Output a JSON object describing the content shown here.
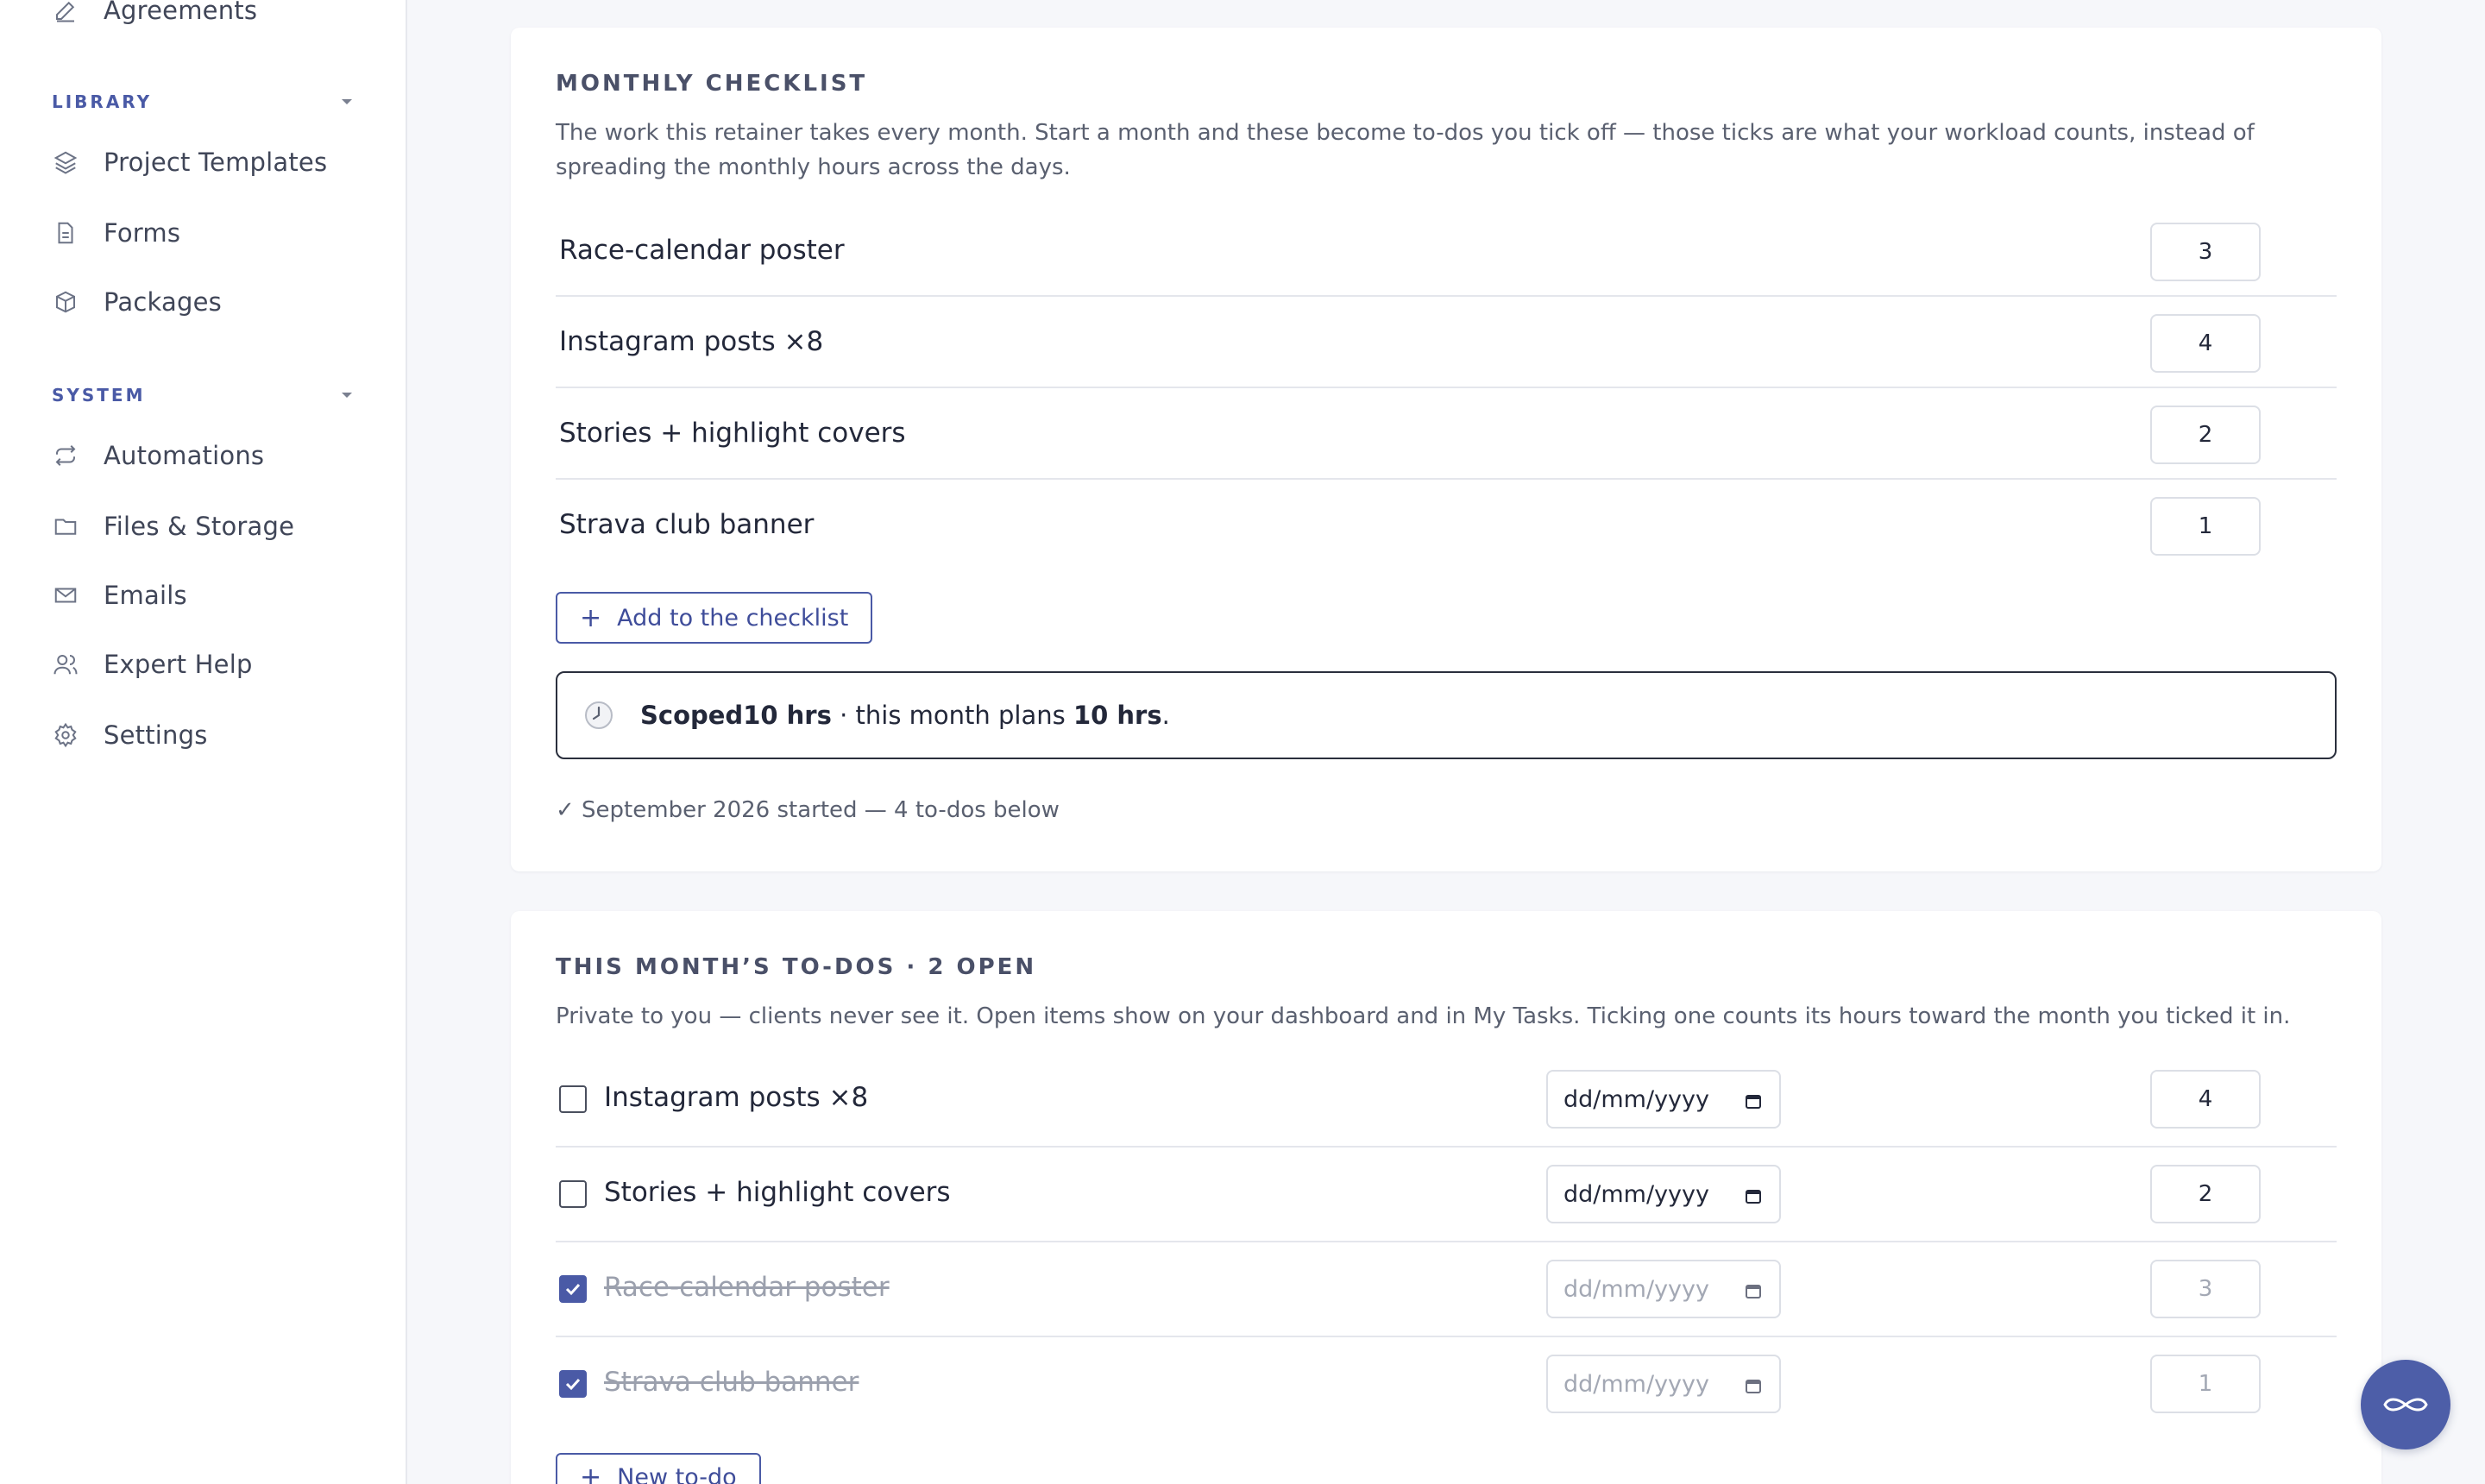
{
  "sidebar": {
    "top_item": "Agreements",
    "library": {
      "heading": "LIBRARY",
      "items": [
        "Project Templates",
        "Forms",
        "Packages"
      ]
    },
    "system": {
      "heading": "SYSTEM",
      "items": [
        "Automations",
        "Files & Storage",
        "Emails",
        "Expert Help",
        "Settings"
      ]
    },
    "icons": [
      "pencil-icon",
      "layers-icon",
      "document-icon",
      "box-icon",
      "refresh-icon",
      "folder-icon",
      "mail-icon",
      "users-icon",
      "gear-icon"
    ]
  },
  "checklist": {
    "title": "MONTHLY CHECKLIST",
    "description": "The work this retainer takes every month. Start a month and these become to-dos you tick off — those ticks are what your workload counts, instead of spreading the monthly hours across the days.",
    "items": [
      {
        "name": "Race-calendar poster",
        "hours": "3"
      },
      {
        "name": "Instagram posts ×8",
        "hours": "4"
      },
      {
        "name": "Stories + highlight covers",
        "hours": "2"
      },
      {
        "name": "Strava club banner",
        "hours": "1"
      }
    ],
    "add_label": "Add to the checklist",
    "scoped": {
      "prefix": "Scoped ",
      "scoped_hours": "10 hrs",
      "middle": " · this month plans ",
      "planned_hours": "10 hrs",
      "suffix": "."
    },
    "started_note": "✓ September 2026 started — 4 to-dos below"
  },
  "todos": {
    "title": "THIS MONTH’S TO-DOS · 2 OPEN",
    "description": "Private to you — clients never see it. Open items show on your dashboard and in My Tasks. Ticking one counts its hours toward the month you ticked it in.",
    "date_placeholder": "dd/mm/yyyy",
    "items": [
      {
        "name": "Instagram posts ×8",
        "hours": "4",
        "done": false
      },
      {
        "name": "Stories + highlight covers",
        "hours": "2",
        "done": false
      },
      {
        "name": "Race-calendar poster",
        "hours": "3",
        "done": true
      },
      {
        "name": "Strava club banner",
        "hours": "1",
        "done": true
      }
    ],
    "new_label": "New to-do"
  },
  "colors": {
    "accent": "#4a5aa6",
    "fab": "#4d5ea8"
  }
}
